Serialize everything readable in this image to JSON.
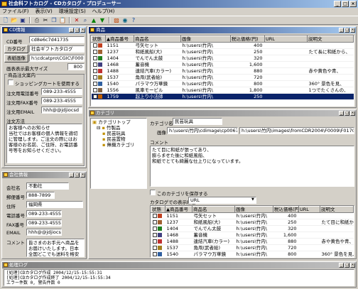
{
  "app": {
    "title": "社会科フトカログ - CDカタログ・プロデューサー"
  },
  "menu": [
    "ファイル(F)",
    "表示(V)",
    "環境設定(S)",
    "ヘルプ(H)"
  ],
  "toolbar": [
    "new-icon",
    "open-icon",
    "save-icon",
    "print-icon",
    "cut-icon",
    "copy-icon",
    "paste-icon",
    "delete-icon",
    "find-icon",
    "up-icon",
    "down-icon",
    "image-icon",
    "preview-icon",
    "help-icon"
  ],
  "cd_panel": {
    "title": "CD情報",
    "cd_number_label": "CD番号",
    "cd_number": "cd8e6c7d41735",
    "catalog_name_btn": "カタログ名",
    "catalog_name": "社会ギフトカタログ",
    "display_image_btn": "表紙画像",
    "display_image": "h:\\cdcatpro\\CGIC\\F0005.JPG",
    "image_size_label": "画表表示最大サイズ",
    "image_size": "800",
    "product_group": "商品注文案内",
    "shopping_cart_label": "ショッピングカートを使用する",
    "order_phone_label": "注文用電話番号",
    "order_phone": "089-233-4555",
    "order_fax_label": "注文用FAX番号",
    "order_fax": "089-233-4555",
    "order_email_label": "注文用EMAIL",
    "order_email": "hhh@@jdjiocsd",
    "order_method_label": "注文方法",
    "order_method_text": "お客様へのお知らせ\n当社ではお客様の個人情報を適切に管理します。ご注文の際にはお客様のお名前、ご住所、お電話番号等をお知らせください。"
  },
  "company_panel": {
    "title": "会社情報",
    "company_label": "会社名",
    "company": "不動社",
    "zip_label": "郵便番号",
    "zip": "888-7899",
    "address_label": "住所",
    "address": "福岡県",
    "phone_label": "電話番号",
    "phone": "089-233-4555",
    "fax_label": "FAX番号",
    "fax": "089-233-4555",
    "email_label": "EMAIL",
    "email": "hhh@@jdjiocsd",
    "comment_label": "コメント",
    "comment_text": "皆さまのお手元へ商品をお届けいたします。日本全国どこでも送料を格安にてご提供いたします。"
  },
  "product_panel": {
    "title": "商品",
    "columns": [
      "状態",
      "▲商品番号",
      "商品名",
      "画像",
      "税込価格(円)",
      "URL",
      "説明文"
    ],
    "rows": [
      {
        "no": "1151",
        "name": "弓矢セット",
        "img": "h:\\users\\竹内\\",
        "price": "400",
        "url": "",
        "desc": ""
      },
      {
        "no": "1237",
        "name": "和紙風船(大)",
        "img": "h:\\users\\竹内\\",
        "price": "250",
        "url": "",
        "desc": "たて長に和紙から、"
      },
      {
        "no": "1404",
        "name": "でんでん太鼓",
        "img": "h:\\users\\竹内\\",
        "price": "320",
        "url": "",
        "desc": ""
      },
      {
        "no": "1468",
        "name": "蓄音機",
        "img": "h:\\users\\竹内\\",
        "price": "1,600",
        "url": "",
        "desc": ""
      },
      {
        "no": "1488",
        "name": "連結汽車(カラー)",
        "img": "h:\\users\\竹内\\",
        "price": "880",
        "url": "",
        "desc": "赤や黄色や青、"
      },
      {
        "no": "1537",
        "name": "角凧(武者絵)",
        "img": "h:\\users\\竹内\\",
        "price": "720",
        "url": "",
        "desc": ""
      },
      {
        "no": "1540",
        "name": "パラマウ万華鏡",
        "img": "h:\\users\\竹内\\",
        "price": "800",
        "url": "",
        "desc": "360° 景色を見、"
      },
      {
        "no": "1556",
        "name": "風車モービル",
        "img": "h:\\users\\竹内\\",
        "price": "1,800",
        "url": "",
        "desc": "1つでたくさんの、"
      },
      {
        "no": "1759",
        "name": "起上り小法師",
        "img": "h:\\users\\竹内\\",
        "price": "250",
        "url": "",
        "desc": ""
      }
    ],
    "selected_index": 8
  },
  "category_panel": {
    "title": "カテゴリ",
    "tree": [
      "カテゴリトップ",
      "竹製品",
      "民芸玩具",
      "民芸置物",
      "無機カテゴリ"
    ],
    "name_label": "カテゴリ名",
    "name": "民芸玩具",
    "image_label": "画像",
    "image_path": "h:\\users\\竹内\\cdimage\\cp0067D.cm",
    "image_path2": "h:\\users\\竹内\\images\\fromCDR2004\\F0009\\F0170.jpg",
    "comment_label": "コメント",
    "comment_text": "たて目に和紙が張ってあり、\n膨らませた後に和紙風船、\n和紙でとても綺麗な仕上りになっています。",
    "save_check_label": "このカテゴリを保存する",
    "display_order_label": "カタログでの表示順番",
    "display_order": "URL",
    "columns": [
      "状態",
      "▲商品番号",
      "商品名",
      "画像",
      "税込価格(円)",
      "URL",
      "説明文"
    ],
    "rows": [
      {
        "no": "1151",
        "name": "弓矢セット",
        "img": "h:\\users\\竹内\\",
        "price": "400",
        "desc": ""
      },
      {
        "no": "1237",
        "name": "和紙風船(大)",
        "img": "h:\\users\\竹内\\",
        "price": "250",
        "desc": "たて目に和紙から、"
      },
      {
        "no": "1404",
        "name": "でんでん太鼓",
        "img": "h:\\users\\竹内\\",
        "price": "320",
        "desc": ""
      },
      {
        "no": "1468",
        "name": "蓄音機",
        "img": "h:\\users\\竹内\\",
        "price": "1,600",
        "desc": ""
      },
      {
        "no": "1488",
        "name": "連結汽車(カラー)",
        "img": "h:\\users\\竹内\\",
        "price": "880",
        "desc": "赤や黄色や青、"
      },
      {
        "no": "1537",
        "name": "角凧(武者絵)",
        "img": "h:\\users\\竹内\\",
        "price": "720",
        "desc": ""
      },
      {
        "no": "1540",
        "name": "パラマウ万華鏡",
        "img": "h:\\users\\竹内\\",
        "price": "800",
        "desc": "360° 景色を見、"
      },
      {
        "no": "1556",
        "name": "風車モービル",
        "img": "h:\\users\\竹内\\",
        "price": "1,800",
        "desc": "1つでたくさんの、"
      }
    ]
  },
  "log_panel": {
    "title": "処理ログ",
    "lines": [
      "[処理]CDカタログ作成 2004/12/15-15:55:31",
      "[処理]CDカタログ作成終了 2004/12/15-15:55:34",
      "エラー件数 0, 警告件数 0"
    ]
  },
  "colors": {
    "titlebar": "#0a246a",
    "selection": "#0a246a",
    "face": "#d4d0c8"
  }
}
